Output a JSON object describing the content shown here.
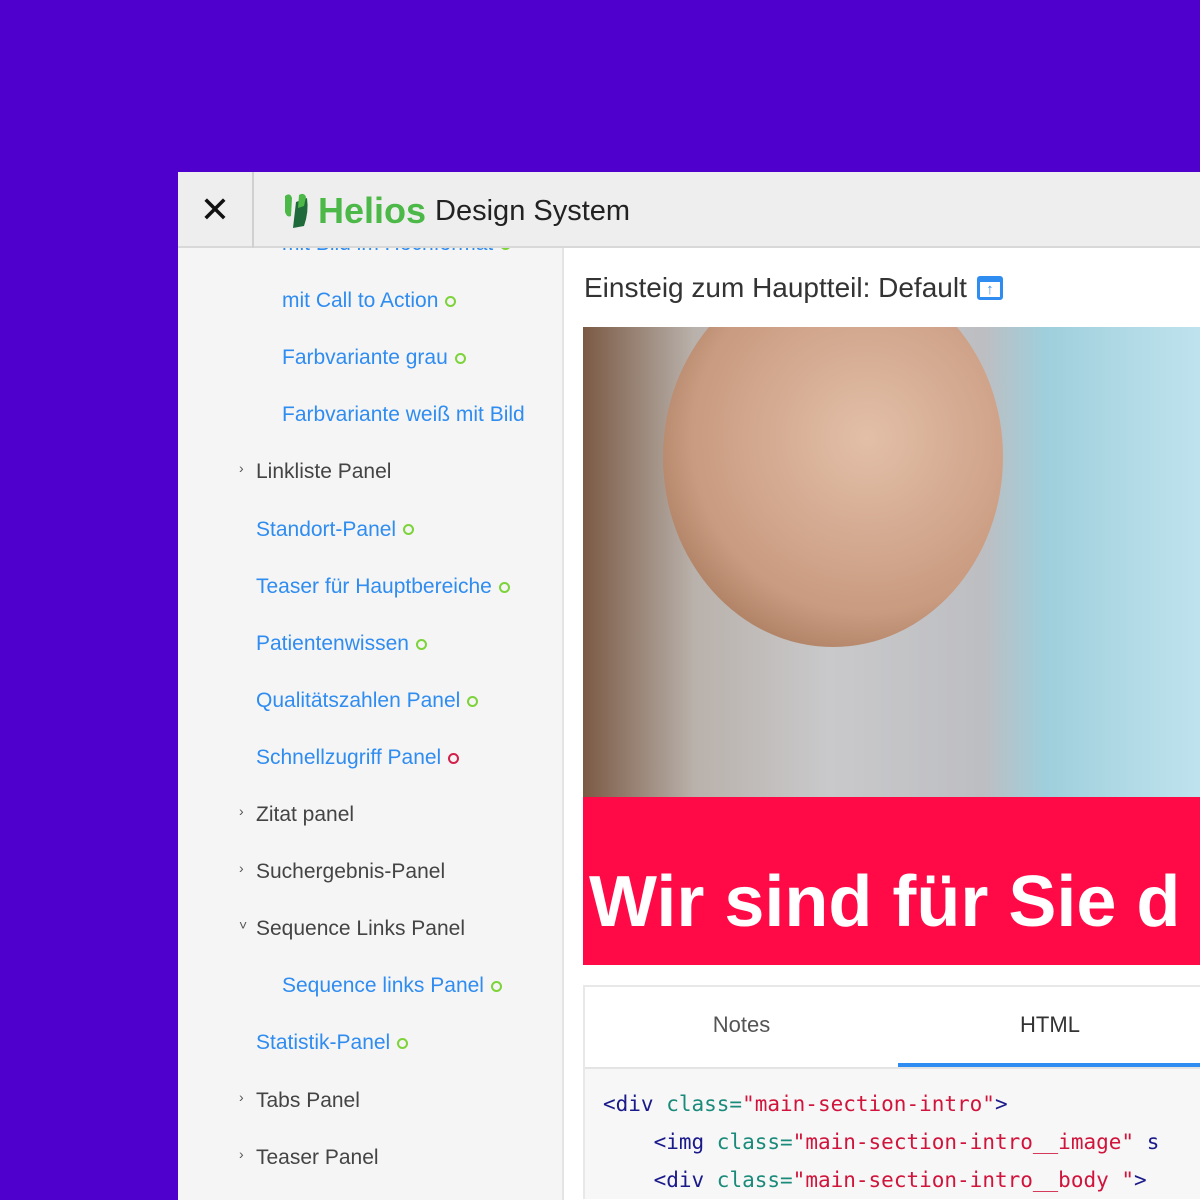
{
  "header": {
    "brand": "Helios",
    "subtitle": "Design System",
    "close_icon": "close-icon",
    "brand_color": "#4cb848"
  },
  "sidebar": {
    "items": [
      {
        "label": "mit Bild im Hochformat",
        "type": "link",
        "level": 2,
        "status": "green"
      },
      {
        "label": "mit Call to Action",
        "type": "link",
        "level": 2,
        "status": "green"
      },
      {
        "label": "Farbvariante grau",
        "type": "link",
        "level": 2,
        "status": "green"
      },
      {
        "label": "Farbvariante weiß mit Bild",
        "type": "link",
        "level": 2
      },
      {
        "label": "Linkliste Panel",
        "type": "group",
        "level": 1,
        "expanded": false
      },
      {
        "label": "Standort-Panel",
        "type": "link",
        "level": 1,
        "status": "green"
      },
      {
        "label": "Teaser für Hauptbereiche",
        "type": "link",
        "level": 1,
        "status": "green"
      },
      {
        "label": "Patientenwissen",
        "type": "link",
        "level": 1,
        "status": "green"
      },
      {
        "label": "Qualitätszahlen Panel",
        "type": "link",
        "level": 1,
        "status": "green"
      },
      {
        "label": "Schnellzugriff Panel",
        "type": "link",
        "level": 1,
        "status": "red"
      },
      {
        "label": "Zitat panel",
        "type": "group",
        "level": 1,
        "expanded": false
      },
      {
        "label": "Suchergebnis-Panel",
        "type": "group",
        "level": 1,
        "expanded": false
      },
      {
        "label": "Sequence Links Panel",
        "type": "group",
        "level": 1,
        "expanded": true
      },
      {
        "label": "Sequence links Panel",
        "type": "link",
        "level": 2,
        "status": "green"
      },
      {
        "label": "Statistik-Panel",
        "type": "link",
        "level": 1,
        "status": "green"
      },
      {
        "label": "Tabs Panel",
        "type": "group",
        "level": 1,
        "expanded": false
      },
      {
        "label": "Teaser Panel",
        "type": "group",
        "level": 1,
        "expanded": false
      }
    ]
  },
  "main": {
    "title": "Einsteig zum Hauptteil: Default",
    "open_icon": "open-external-icon",
    "banner_text": "Wir sind für Sie d",
    "tabs": [
      {
        "label": "Notes",
        "active": false
      },
      {
        "label": "HTML",
        "active": true
      }
    ],
    "code": [
      {
        "indent": "",
        "tag": "<div",
        "attr": " class=",
        "val": "\"main-section-intro\"",
        "end": ">"
      },
      {
        "indent": "    ",
        "tag": "<img",
        "attr": " class=",
        "val": "\"main-section-intro__image\"",
        "end": " s"
      },
      {
        "indent": "    ",
        "tag": "<div",
        "attr": " class=",
        "val": "\"main-section-intro__body \"",
        "end": ">"
      }
    ]
  }
}
